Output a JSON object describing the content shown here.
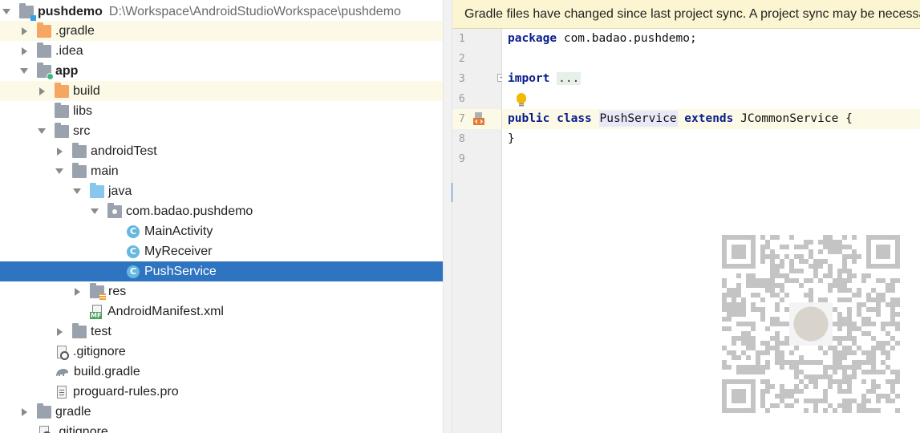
{
  "project_tree": {
    "root": {
      "name": "pushdemo",
      "path": "D:\\Workspace\\AndroidStudioWorkspace\\pushdemo"
    },
    "items": [
      {
        "label": ".gradle",
        "icon": "folder-icon"
      },
      {
        "label": ".idea",
        "icon": "folder-icon"
      },
      {
        "label": "app",
        "icon": "module-folder-icon"
      },
      {
        "label": "build",
        "icon": "folder-icon"
      },
      {
        "label": "libs",
        "icon": "folder-icon"
      },
      {
        "label": "src",
        "icon": "folder-icon"
      },
      {
        "label": "androidTest",
        "icon": "folder-icon"
      },
      {
        "label": "main",
        "icon": "folder-icon"
      },
      {
        "label": "java",
        "icon": "source-folder-icon"
      },
      {
        "label": "com.badao.pushdemo",
        "icon": "package-icon"
      },
      {
        "label": "MainActivity",
        "icon": "class-icon"
      },
      {
        "label": "MyReceiver",
        "icon": "class-icon"
      },
      {
        "label": "PushService",
        "icon": "class-icon"
      },
      {
        "label": "res",
        "icon": "resource-folder-icon"
      },
      {
        "label": "AndroidManifest.xml",
        "icon": "manifest-icon"
      },
      {
        "label": "test",
        "icon": "folder-icon"
      },
      {
        "label": ".gitignore",
        "icon": "gitignore-icon"
      },
      {
        "label": "build.gradle",
        "icon": "gradle-icon"
      },
      {
        "label": "proguard-rules.pro",
        "icon": "text-file-icon"
      },
      {
        "label": "gradle",
        "icon": "folder-icon"
      },
      {
        "label": ".gitignore",
        "icon": "gitignore-icon"
      }
    ],
    "selected": "PushService"
  },
  "editor": {
    "banner": "Gradle files have changed since last project sync. A project sync may be necessary for the IDE to work properly.",
    "line_numbers": [
      "1",
      "2",
      "3",
      "6",
      "7",
      "8",
      "9"
    ],
    "code": {
      "package_kw": "package",
      "package_name": " com.badao.pushdemo;",
      "import_kw": "import",
      "import_fold": "...",
      "public_kw": "public",
      "class_kw": "class",
      "class_name": "PushService",
      "extends_kw": "extends",
      "super_class": " JCommonService {",
      "close_brace": "}"
    }
  },
  "colors": {
    "selection": "#2f74c0",
    "banner_bg": "#fcf5d2",
    "keyword": "#0a1d8c",
    "highlight_row": "#fcfae6"
  }
}
